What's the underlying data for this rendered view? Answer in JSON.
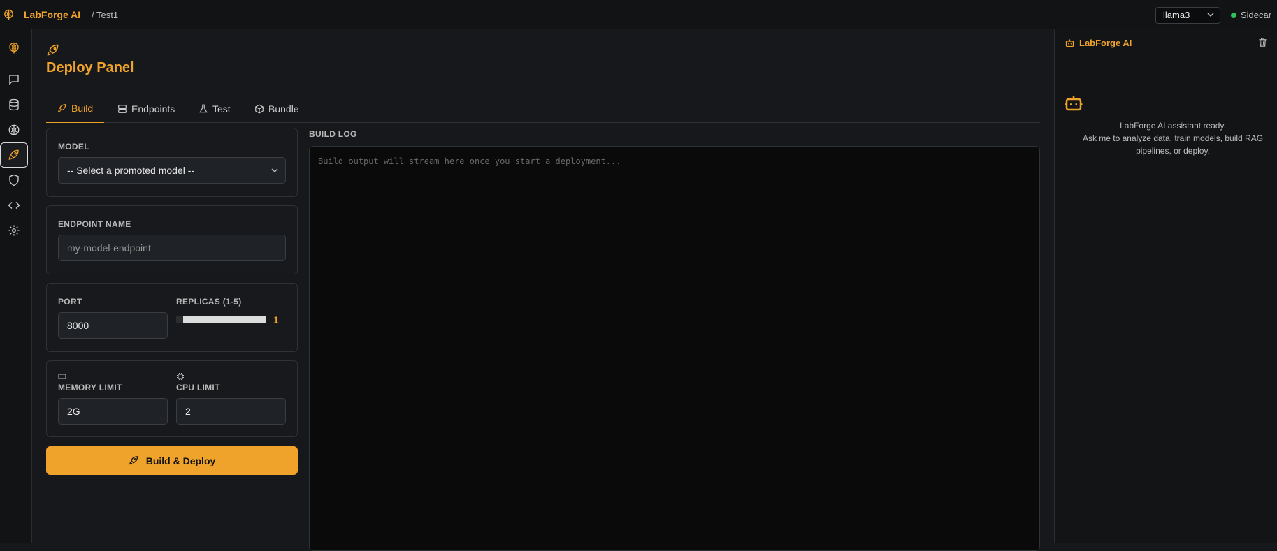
{
  "app": {
    "name": "LabForge AI",
    "breadcrumb": "/ Test1"
  },
  "topbar": {
    "model_selected": "llama3",
    "sidecar_label": "Sidecar",
    "sidecar_status_color": "#2fbf5b"
  },
  "rail": {
    "items": [
      {
        "name": "brain",
        "active": false
      },
      {
        "name": "chat",
        "active": false
      },
      {
        "name": "database",
        "active": false
      },
      {
        "name": "train",
        "active": false
      },
      {
        "name": "deploy",
        "active": true
      },
      {
        "name": "shield",
        "active": false
      },
      {
        "name": "code",
        "active": false
      },
      {
        "name": "settings",
        "active": false
      }
    ]
  },
  "page": {
    "title": "Deploy Panel"
  },
  "tabs": [
    {
      "label": "Build",
      "icon": "rocket-icon",
      "active": true
    },
    {
      "label": "Endpoints",
      "icon": "server-icon",
      "active": false
    },
    {
      "label": "Test",
      "icon": "flask-icon",
      "active": false
    },
    {
      "label": "Bundle",
      "icon": "package-icon",
      "active": false
    }
  ],
  "form": {
    "model": {
      "label": "MODEL",
      "selected": "-- Select a promoted model --"
    },
    "endpoint": {
      "label": "ENDPOINT NAME",
      "placeholder": "my-model-endpoint"
    },
    "port": {
      "label": "PORT",
      "value": "8000"
    },
    "replicas": {
      "label": "REPLICAS (1-5)",
      "value": "1",
      "min": 1,
      "max": 5
    },
    "memory": {
      "label": "MEMORY LIMIT",
      "value": "2G"
    },
    "cpu": {
      "label": "CPU LIMIT",
      "value": "2"
    },
    "submit_label": "Build & Deploy"
  },
  "build_log": {
    "label": "BUILD LOG",
    "placeholder": "Build output will stream here once you start a deployment..."
  },
  "assistant": {
    "title": "LabForge AI",
    "ready": "LabForge AI assistant ready.",
    "hint": "Ask me to analyze data, train models, build RAG pipelines, or deploy."
  },
  "colors": {
    "accent": "#f0a32a",
    "background": "#16181b"
  }
}
